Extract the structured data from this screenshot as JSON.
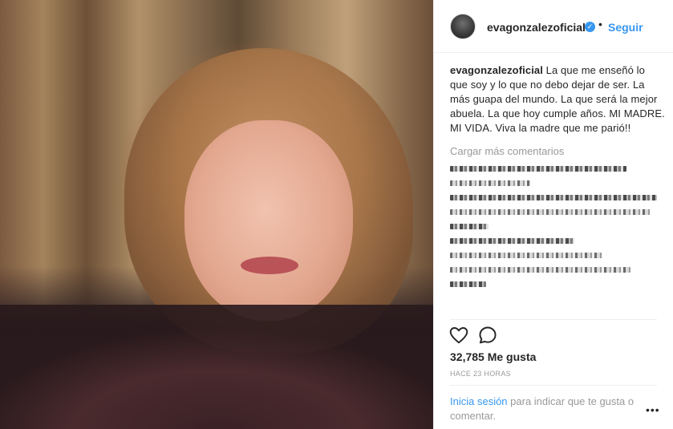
{
  "post": {
    "photo_alt": "photo",
    "username": "evagonzalezoficial",
    "verified_icon": "✓",
    "separator": "•",
    "follow_label": "Seguir",
    "caption_user": "evagonzalezoficial",
    "caption_text": " La que me enseñó lo que soy y lo que no debo dejar de ser. La más guapa del mundo. La que será la mejor abuela. La que hoy cumple años. MI MADRE. MI VIDA. Viva la madre que me parió!!",
    "load_more": "Cargar más comentarios",
    "likes": "32,785 Me gusta",
    "time": "HACE 23 HORAS",
    "login_link": "Inicia sesión",
    "login_text": " para indicar que te gusta o comentar.",
    "more_label": "•••"
  },
  "icons": {
    "heart": "heart-icon",
    "comment": "comment-icon",
    "verified": "verified-badge-icon",
    "more": "more-options-icon"
  },
  "colors": {
    "link": "#3897f0",
    "text": "#262626",
    "muted": "#999999",
    "border": "#efefef"
  }
}
